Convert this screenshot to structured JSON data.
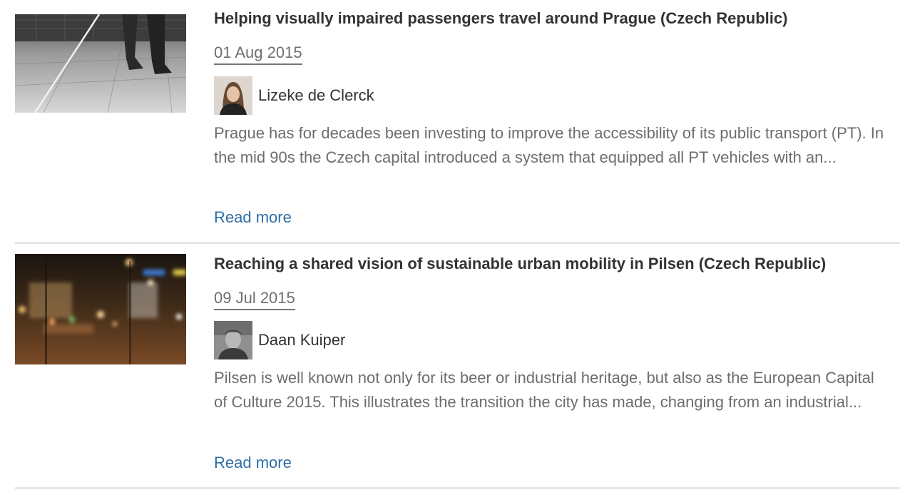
{
  "articles": [
    {
      "title": "Helping visually impaired passengers travel around Prague (Czech Republic)",
      "date": "01 Aug 2015",
      "author": "Lizeke de Clerck",
      "excerpt": "Prague has for decades been investing to improve the accessibility of its public transport (PT). In the mid 90s the Czech capital introduced a system that equipped all PT vehicles with an...",
      "read_more": "Read more",
      "thumbnail": "white-cane-on-pavement-photo",
      "avatar": "woman-portrait-photo"
    },
    {
      "title": "Reaching a shared vision of sustainable urban mobility in Pilsen (Czech Republic)",
      "date": "09 Jul 2015",
      "author": "Daan Kuiper",
      "excerpt": "Pilsen is well known not only for its beer or industrial heritage, but also as the European Capital of Culture 2015. This illustrates the transition the city has made, changing from an industrial...",
      "read_more": "Read more",
      "thumbnail": "blurred-city-lights-night-photo",
      "avatar": "man-portrait-photo"
    }
  ],
  "colors": {
    "link": "#2e6da4",
    "title": "#333333",
    "meta": "#6f6f6f",
    "divider": "#e6e6e6"
  }
}
